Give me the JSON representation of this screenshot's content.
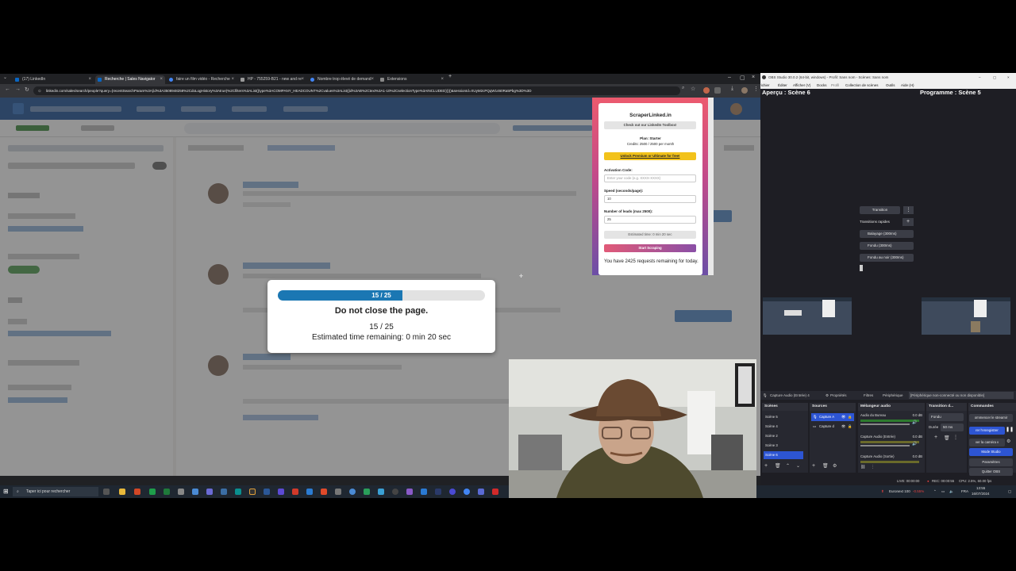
{
  "browser": {
    "tabs": [
      {
        "label": "(17) LinkedIn",
        "color": "#0a66c2"
      },
      {
        "label": "Recherche | Sales Navigator",
        "color": "#0a66c2"
      },
      {
        "label": "faire un film vidéo - Recherche",
        "color": "#4285f4"
      },
      {
        "label": "HP - 755259-B21 - new and re",
        "color": "#999999"
      },
      {
        "label": "Nombre trop élevé de demand",
        "color": "#4285f4"
      },
      {
        "label": "Extensions",
        "color": "#888888"
      }
    ],
    "new_tab": "+",
    "url": "linkedin.com/sales/search/people?query=(recentSearchParam%3A(id%3A3508948258%2CdoLogHistory%3Atrue)%2Cfilters%3AList((type%3ACOMPANY_HEADCOUNT%2Cvalues%3AList((id%3AB%2Ctext%3A1-10%2CselectionType%3AINCLUDED)))))&sessionId=XUyM2cPQqW1460Ra5Pbg%3D%3D"
  },
  "modal": {
    "progress": {
      "current": 15,
      "total": 25
    },
    "progress_text": "15 / 25",
    "title": "Do not close the page.",
    "count": "15 / 25",
    "eta": "Estimated time remaining: 0 min 20 sec"
  },
  "extension": {
    "title": "ScraperLinked.in",
    "toolbox": "Check out our LinkedIn Toolbox!",
    "plan": "Plan: Starter",
    "credits": "Credits: 2500 / 2500 per month",
    "unlock": "Unlock Premium or Ultimate for free!",
    "activation_label": "Activation Code:",
    "activation_placeholder": "Enter your code (e.g. XXXX-XXXX)",
    "speed_label": "Speed (seconds/page):",
    "speed_value": "10",
    "leads_label": "Number of leads (max 2500):",
    "leads_value": "25",
    "estimated": "Estimated time: 0 min 20 sec",
    "start": "Start Scraping",
    "remaining": "You have 2425 requests remaining for today."
  },
  "taskbar": {
    "search_placeholder": "Taper ici pour rechercher"
  },
  "obs": {
    "title": "OBS Studio 30.0.2 (64-bit, windows) - Profil: Sans nom - Scènes: Sans nom",
    "menu": [
      "Fichier",
      "Éditer",
      "Afficher (V)",
      "Docks",
      "Profil",
      "Collection de scènes",
      "Outils",
      "Aide (H)"
    ],
    "preview_title": "Aperçu : Scène 6",
    "program_title": "Programme : Scène 5",
    "transition_btn": "Transition",
    "quick_transitions": "Transitions rapides",
    "quick_items": [
      "Balayage (300ms)",
      "Fondu (300ms)",
      "Fondu au noir (300ms)"
    ],
    "source_bar": {
      "source": "Capture Audio (Entrée) 4",
      "properties": "Propriétés",
      "filters": "Filtres",
      "device_label": "Périphérique",
      "device_value": "[Périphérique non-connecté ou non disponible]"
    },
    "scenes_header": "Scènes",
    "scenes": [
      "Scène 5",
      "Scène 4",
      "Scène 2",
      "Scène 3",
      "Scène 6"
    ],
    "sources_header": "Sources",
    "sources": [
      "Capture A",
      "Capture d"
    ],
    "mixer_header": "Mélangeur audio",
    "mixer": [
      {
        "name": "Audio du Bureau",
        "db": "0.0 dB"
      },
      {
        "name": "Capture Audio (Entrée)",
        "db": "0.0 dB"
      },
      {
        "name": "Capture Audio (Sortie)",
        "db": "0.0 dB"
      }
    ],
    "transition_header": "Transition d...",
    "transition_type": "Fondu",
    "duration_label": "Durée",
    "duration_value": "50 ms",
    "commands_header": "Commandes",
    "commands": [
      "ommencer le streamir",
      "rer l'enregistrer",
      "ver la caméra v",
      "Mode Studio",
      "Paramètres",
      "Quitter OBS"
    ],
    "status": {
      "live": "LIVE: 00:00:00",
      "rec": "REC: 00:00:55",
      "cpu": "CPU: 2.5%, 60.00 fps"
    },
    "tray": {
      "ticker": "Euronext 100",
      "change": "-0.55%",
      "lang": "FRA",
      "time": "13:55",
      "date": "16/07/2024"
    }
  }
}
